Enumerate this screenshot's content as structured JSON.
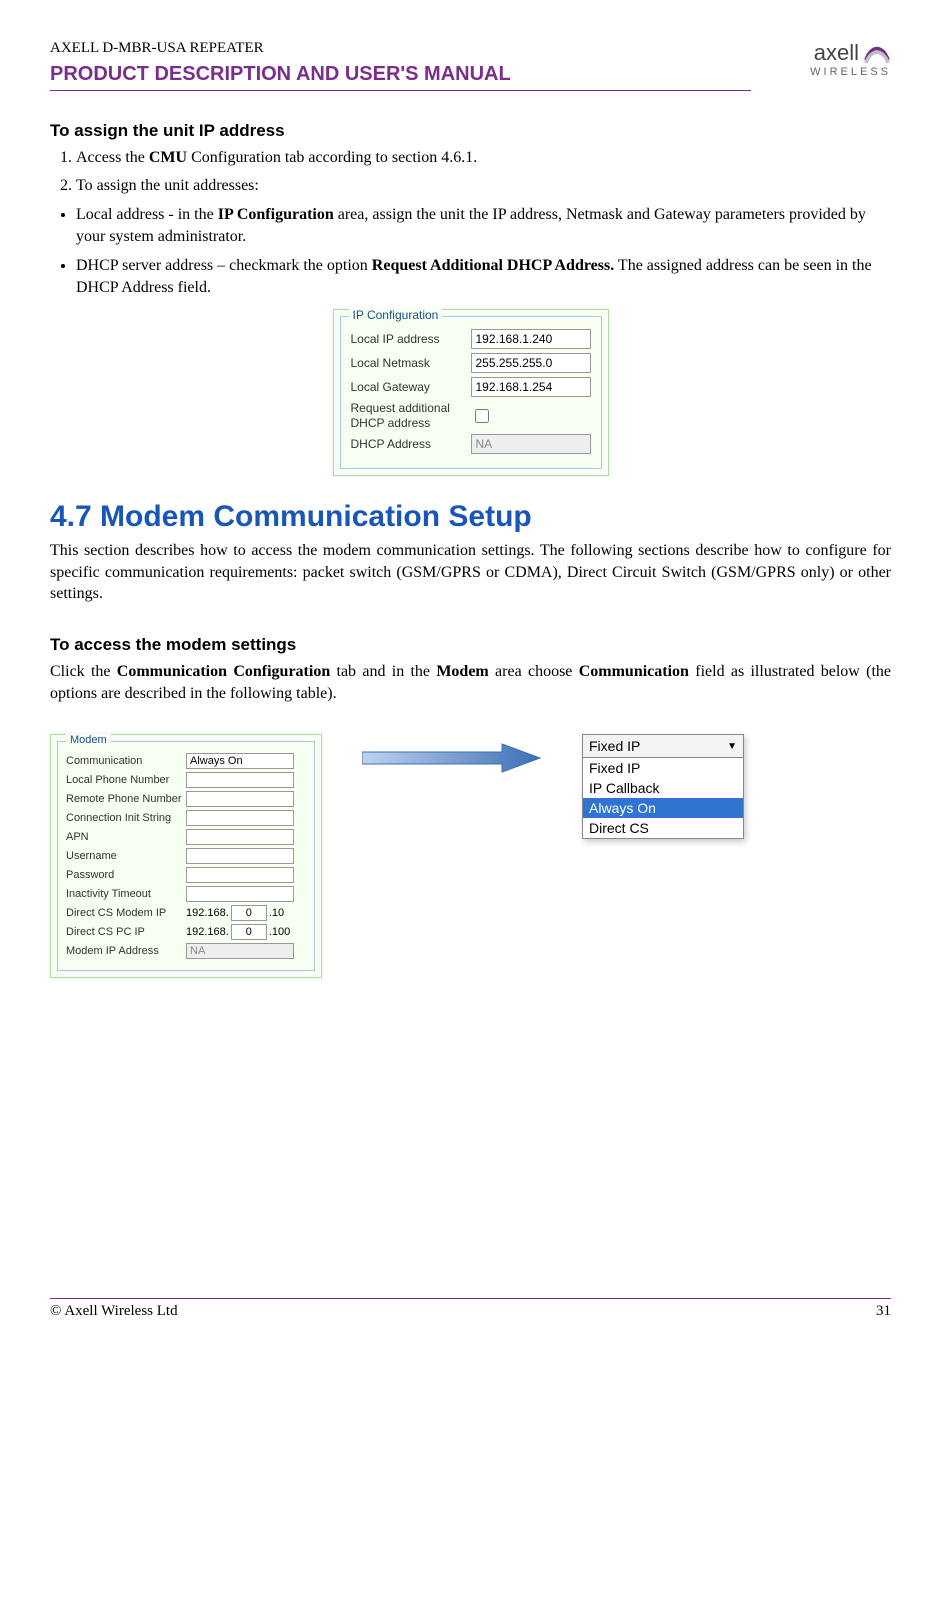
{
  "header": {
    "small": "AXELL D-MBR-USA REPEATER",
    "main": "PRODUCT DESCRIPTION AND USER'S MANUAL",
    "logo_top": "axell",
    "logo_bottom": "WIRELESS"
  },
  "subheading1": "To assign the unit IP address",
  "step1_pre": "Access the ",
  "step1_bold": "CMU",
  "step1_post": " Configuration tab according to section 4.6.1.",
  "step2": "To assign the unit addresses:",
  "bullet1_pre": "Local address - in the ",
  "bullet1_bold": "IP Configuration",
  "bullet1_post": " area, assign the unit the IP address, Netmask and Gateway parameters provided by your system administrator.",
  "bullet2_pre": "DHCP server address – checkmark the option ",
  "bullet2_bold": "Request Additional DHCP Address.",
  "bullet2_post": " The assigned address can be seen in the DHCP Address field.",
  "ipconfig": {
    "legend": "IP Configuration",
    "rows": {
      "local_ip_label": "Local IP address",
      "local_ip_value": "192.168.1.240",
      "netmask_label": "Local Netmask",
      "netmask_value": "255.255.255.0",
      "gateway_label": "Local Gateway",
      "gateway_value": "192.168.1.254",
      "req_label": "Request additional DHCP address",
      "dhcp_label": "DHCP Address",
      "dhcp_value": "NA"
    }
  },
  "section_title": "4.7   Modem Communication Setup",
  "para1": "This section describes how to access the modem communication settings. The following sections describe how to configure for specific communication requirements: packet switch (GSM/GPRS or CDMA), Direct Circuit Switch (GSM/GPRS only) or other settings.",
  "subheading2": "To access the modem settings",
  "para2_pre": "Click the ",
  "para2_b1": "Communication Configuration",
  "para2_mid1": " tab and in the ",
  "para2_b2": "Modem",
  "para2_mid2": " area choose ",
  "para2_b3": "Communication",
  "para2_post": " field as illustrated below (the options are described in the following table).",
  "modem": {
    "legend": "Modem",
    "communication_label": "Communication",
    "communication_value": "Always On",
    "local_phone_label": "Local Phone Number",
    "remote_phone_label": "Remote Phone Number",
    "conn_init_label": "Connection Init String",
    "apn_label": "APN",
    "username_label": "Username",
    "password_label": "Password",
    "inactivity_label": "Inactivity Timeout",
    "direct_cs_modem_label": "Direct CS Modem IP",
    "direct_cs_modem_prefix": "192.168.",
    "direct_cs_modem_seg": "0",
    "direct_cs_modem_suffix": ".10",
    "direct_cs_pc_label": "Direct CS PC IP",
    "direct_cs_pc_prefix": "192.168.",
    "direct_cs_pc_seg": "0",
    "direct_cs_pc_suffix": ".100",
    "modem_ip_label": "Modem IP Address",
    "modem_ip_value": "NA"
  },
  "dropdown": {
    "selected": "Fixed IP",
    "opt1": "Fixed IP",
    "opt2": "IP Callback",
    "opt3": "Always On",
    "opt4": "Direct CS"
  },
  "footer": {
    "left": "© Axell Wireless Ltd",
    "right": "31"
  }
}
